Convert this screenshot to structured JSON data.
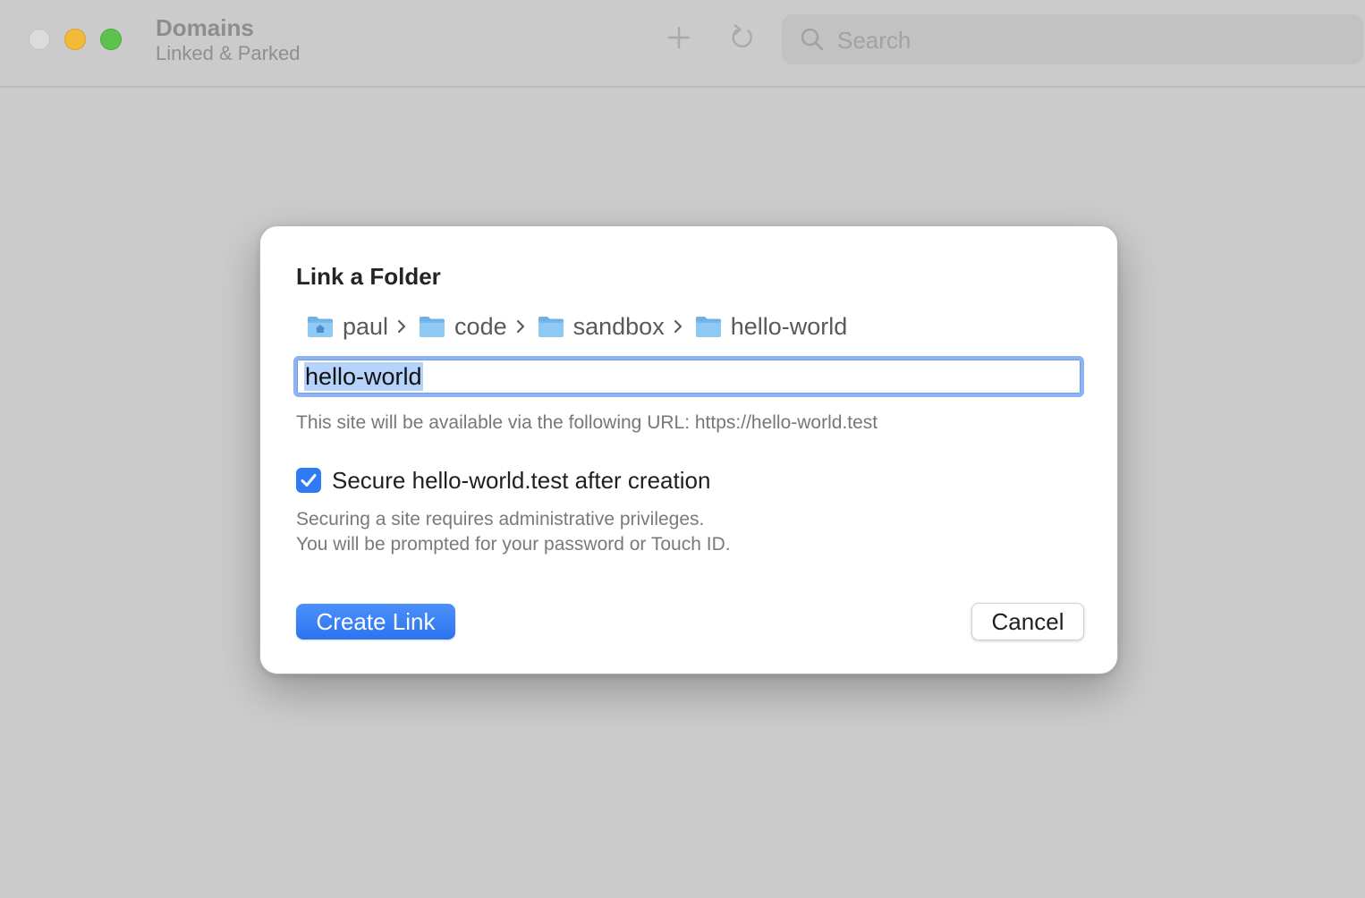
{
  "window": {
    "title": "Domains",
    "subtitle": "Linked & Parked",
    "toolbar": {
      "add_icon": "plus-icon",
      "refresh_icon": "refresh-icon",
      "search_placeholder": "Search"
    }
  },
  "dialog": {
    "title": "Link a Folder",
    "breadcrumb": [
      {
        "label": "paul",
        "icon": "home-folder-icon"
      },
      {
        "label": "code",
        "icon": "folder-icon"
      },
      {
        "label": "sandbox",
        "icon": "folder-icon"
      },
      {
        "label": "hello-world",
        "icon": "folder-icon"
      }
    ],
    "name_input_value": "hello-world",
    "url_hint": "This site will be available via the following URL: https://hello-world.test",
    "secure_checkbox": {
      "checked": true,
      "label": "Secure hello-world.test after creation"
    },
    "note_line1": "Securing a site requires administrative privileges.",
    "note_line2": "You will be prompted for your password or Touch ID.",
    "primary_button": "Create Link",
    "cancel_button": "Cancel"
  },
  "colors": {
    "accent": "#2f7bf6",
    "background": "#cccccc",
    "close": "#dcdcdc",
    "minimize": "#f3b938",
    "zoom": "#5fc24f"
  }
}
